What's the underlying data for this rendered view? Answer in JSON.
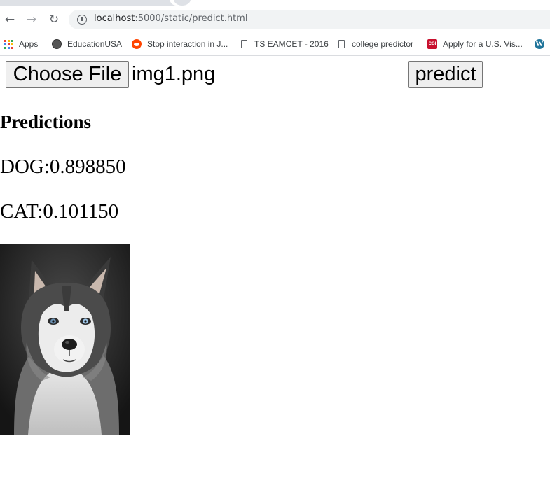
{
  "browser": {
    "url_host": "localhost",
    "url_path": ":5000/static/predict.html",
    "bookmarks": [
      {
        "label": "Apps",
        "icon": "apps-grid-icon"
      },
      {
        "label": "EducationUSA",
        "icon": "seal-icon"
      },
      {
        "label": "Stop interaction in J...",
        "icon": "reddit-icon"
      },
      {
        "label": "TS EAMCET - 2016",
        "icon": "page-icon"
      },
      {
        "label": "college predictor",
        "icon": "page-icon"
      },
      {
        "label": "Apply for a U.S. Vis...",
        "icon": "cgi-icon"
      }
    ],
    "wordpress_icon": "W",
    "cgi_icon_text": "CGI"
  },
  "form": {
    "choose_file_label": "Choose File",
    "file_name": "img1.png",
    "predict_label": "predict"
  },
  "results": {
    "heading": "Predictions",
    "predictions": [
      {
        "text": "DOG:0.898850",
        "label": "DOG",
        "probability": 0.89885
      },
      {
        "text": "CAT:0.101150",
        "label": "CAT",
        "probability": 0.10115
      }
    ]
  },
  "colors": {
    "button_bg": "#efefef",
    "button_border": "#767676",
    "tabstrip": "#dee1e6",
    "omnibox": "#f1f3f4"
  }
}
